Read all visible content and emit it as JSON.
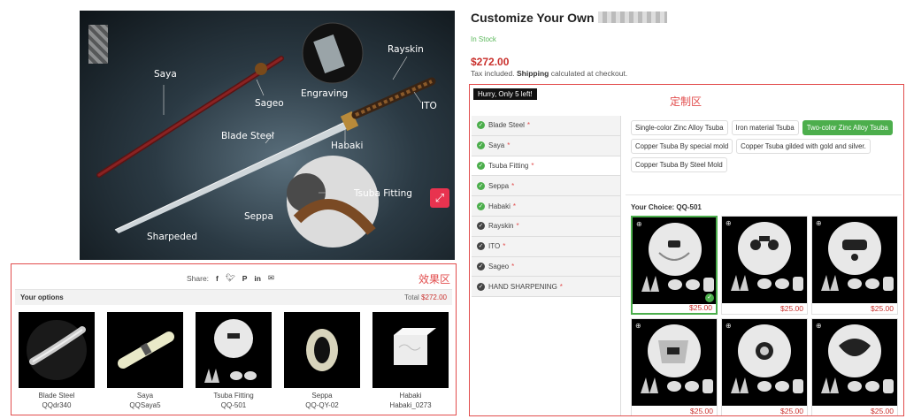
{
  "hero": {
    "labels": {
      "saya": "Saya",
      "sageo": "Sageo",
      "engraving": "Engraving",
      "rayskin": "Rayskin",
      "ito": "ITO",
      "blade_steel": "Blade Steel",
      "habaki": "Habaki",
      "tsuba_fitting": "Tsuba Fitting",
      "seppa": "Seppa",
      "sharpeded": "Sharpeded"
    },
    "zoom_icon": "expand-icon"
  },
  "product": {
    "title": "Customize Your Own",
    "stock": "In Stock",
    "price": "$272.00",
    "tax_prefix": "Tax included.",
    "shipping_label": "Shipping",
    "tax_suffix": "calculated at checkout."
  },
  "customize": {
    "hurry": "Hurry, Only 5 left!",
    "zone_label": "定制区",
    "steps": [
      {
        "label": "Blade Steel",
        "state": "done"
      },
      {
        "label": "Saya",
        "state": "done"
      },
      {
        "label": "Tsuba Fitting",
        "state": "done"
      },
      {
        "label": "Seppa",
        "state": "done"
      },
      {
        "label": "Habaki",
        "state": "done"
      },
      {
        "label": "Rayskin",
        "state": "pending"
      },
      {
        "label": "ITO",
        "state": "pending"
      },
      {
        "label": "Sageo",
        "state": "pending"
      },
      {
        "label": "HAND SHARPENING",
        "state": "pending"
      }
    ],
    "options": [
      {
        "label": "Single-color Zinc Alloy Tsuba",
        "selected": false
      },
      {
        "label": "Iron material Tsuba",
        "selected": false
      },
      {
        "label": "Two-color Zinc Alloy Tsuba",
        "selected": true
      },
      {
        "label": "Copper Tsuba By special mold",
        "selected": false
      },
      {
        "label": "Copper Tsuba gilded with gold and silver.",
        "selected": false
      },
      {
        "label": "Copper Tsuba By Steel Mold",
        "selected": false
      }
    ],
    "choice_label": "Your Choice:",
    "choice_value": "QQ-501",
    "tiles": [
      {
        "price": "$25.00",
        "selected": true
      },
      {
        "price": "$25.00",
        "selected": false
      },
      {
        "price": "$25.00",
        "selected": false
      },
      {
        "price": "$25.00",
        "selected": false
      },
      {
        "price": "$25.00",
        "selected": false
      },
      {
        "price": "$25.00",
        "selected": false
      }
    ]
  },
  "effect": {
    "zone_label": "效果区",
    "share_label": "Share:",
    "share_icons": [
      "facebook-icon",
      "twitter-icon",
      "pinterest-icon",
      "linkedin-icon",
      "email-icon"
    ],
    "options_title": "Your options",
    "total_label": "Total",
    "total_value": "$272.00",
    "items": [
      {
        "name": "Blade Steel",
        "code": "QQdr340"
      },
      {
        "name": "Saya",
        "code": "QQSaya5"
      },
      {
        "name": "Tsuba Fitting",
        "code": "QQ-501"
      },
      {
        "name": "Seppa",
        "code": "QQ-QY-02"
      },
      {
        "name": "Habaki",
        "code": "Habaki_0273"
      }
    ]
  },
  "colors": {
    "accent_red": "#e24d4d",
    "price_red": "#c9302c",
    "success_green": "#4cae4c"
  }
}
